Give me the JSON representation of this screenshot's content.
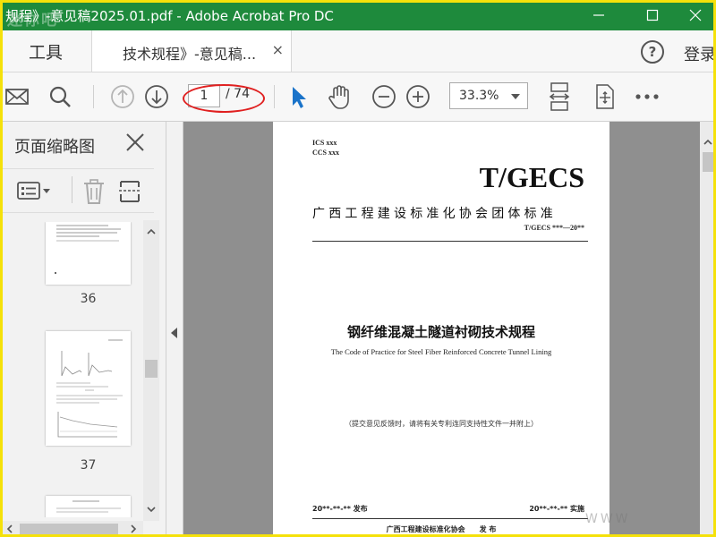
{
  "window": {
    "title": "规程》-意见稿2025.01.pdf - Adobe Acrobat Pro DC",
    "watermark_logo": "迷你吧"
  },
  "tabs": {
    "tools_label": "工具",
    "document_label": "技术规程》-意见稿...",
    "close_symbol": "×",
    "help_symbol": "?",
    "login_label": "登录"
  },
  "toolbar": {
    "current_page": "1",
    "total_pages": "/ 74",
    "zoom": "33.3%"
  },
  "panel": {
    "title": "页面缩略图",
    "thumbnails": [
      {
        "label": "36"
      },
      {
        "label": "37"
      }
    ]
  },
  "document": {
    "ics": "ICS xxx",
    "ccs": "CCS xxx",
    "code": "T/GECS",
    "org_standard": "广西工程建设标准化协会团体标准",
    "number": "T/GECS ***—20**",
    "title_cn": "钢纤维混凝土隧道衬砌技术规程",
    "title_en": "The Code of Practice for Steel Fiber Reinforced Concrete Tunnel Lining",
    "note": "（提交意见反馈时，请将有关专利连同支持性文件一并附上）",
    "issue_date": "20**-**-** 发布",
    "effective_date": "20**-**-** 实施",
    "publisher": "广西工程建设标准化协会　　发 布"
  },
  "watermark": "WWW"
}
